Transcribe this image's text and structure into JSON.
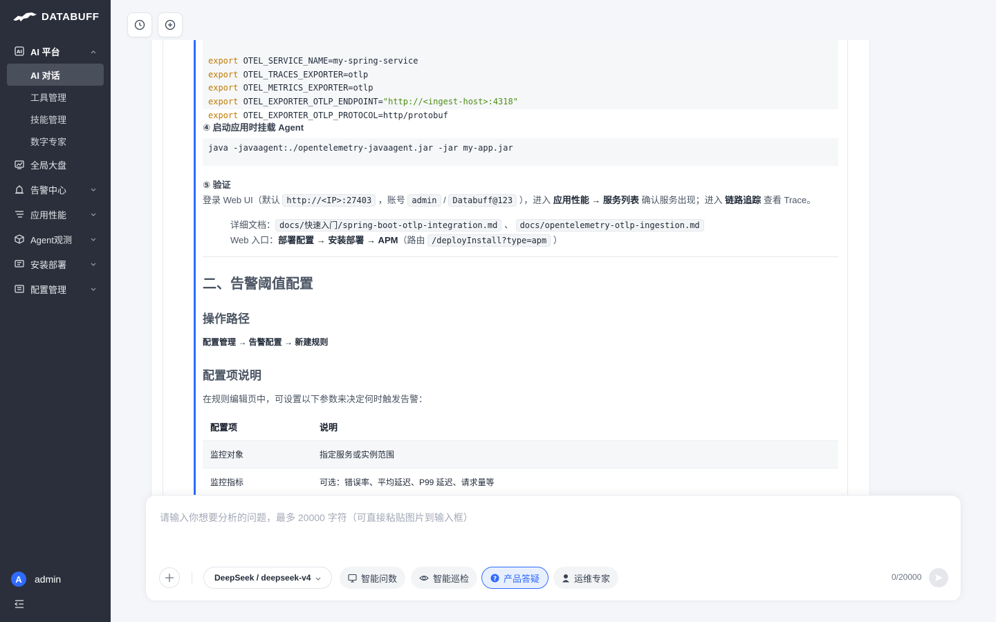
{
  "brand": {
    "name": "DATABUFF"
  },
  "sidebar": {
    "ai_platform": {
      "label": "AI 平台",
      "items": [
        {
          "label": "AI 对话",
          "active": true
        },
        {
          "label": "工具管理"
        },
        {
          "label": "技能管理"
        },
        {
          "label": "数字专家"
        }
      ]
    },
    "items": [
      {
        "label": "全局大盘"
      },
      {
        "label": "告警中心"
      },
      {
        "label": "应用性能"
      },
      {
        "label": "Agent观测"
      },
      {
        "label": "安装部署"
      },
      {
        "label": "配置管理"
      }
    ],
    "user": {
      "initial": "A",
      "name": "admin"
    }
  },
  "content": {
    "env_code": [
      [
        "export",
        " OTEL_SERVICE_NAME=my-spring-service"
      ],
      [
        "export",
        " OTEL_TRACES_EXPORTER=otlp"
      ],
      [
        "export",
        " OTEL_METRICS_EXPORTER=otlp"
      ],
      [
        "export",
        " OTEL_EXPORTER_OTLP_ENDPOINT=",
        "\"http://<ingest-host>:4318\""
      ],
      [
        "export",
        " OTEL_EXPORTER_OTLP_PROTOCOL=http/protobuf"
      ]
    ],
    "step4_title": "④ 启动应用时挂载 Agent",
    "step4_code": "java -javaagent:./opentelemetry-javaagent.jar -jar my-app.jar",
    "step5_title": "⑤ 验证",
    "verify": {
      "t1": "登录 Web UI（默认 ",
      "url": "http://<IP>:27403",
      "t2": " ，账号 ",
      "user": "admin",
      "t3": " / ",
      "pwd": "Databuff@123",
      "t4": " ），进入 ",
      "b1": "应用性能 → 服务列表",
      "t5": " 确认服务出现；进入 ",
      "b2": "链路追踪",
      "t6": " 查看 Trace。"
    },
    "docs": {
      "label": "详细文档：",
      "doc1": "docs/快速入门/spring-boot-otlp-integration.md",
      "sep": " 、 ",
      "doc2": "docs/opentelemetry-otlp-ingestion.md"
    },
    "web_entry": {
      "label": "Web 入口：",
      "path": "部署配置 → 安装部署 → APM",
      "t1": "（路由 ",
      "route": "/deployInstall?type=apm",
      "t2": " ）"
    },
    "h2": "二、告警阈值配置",
    "h3_path": "操作路径",
    "op_path": "配置管理 → 告警配置 → 新建规则",
    "h3_config": "配置项说明",
    "config_desc": "在规则编辑页中，可设置以下参数来决定何时触发告警：",
    "table": {
      "headers": [
        "配置项",
        "说明"
      ],
      "rows": [
        [
          "监控对象",
          "指定服务或实例范围"
        ],
        [
          "监控指标",
          "可选：错误率、平均延迟、P99 延迟、请求量等"
        ]
      ]
    }
  },
  "composer": {
    "placeholder": "请输入你想要分析的问题，最多 20000 字符（可直接粘贴图片到输入框）",
    "model": "DeepSeek / deepseek-v4",
    "modes": [
      {
        "label": "智能问数",
        "icon": "chart-icon"
      },
      {
        "label": "智能巡检",
        "icon": "eye-icon"
      },
      {
        "label": "产品答疑",
        "icon": "question-icon",
        "active": true
      },
      {
        "label": "运维专家",
        "icon": "user-icon"
      }
    ],
    "counter": "0/20000"
  },
  "colors": {
    "accent": "#2f6bff",
    "sidebar": "#2b2f3b"
  }
}
